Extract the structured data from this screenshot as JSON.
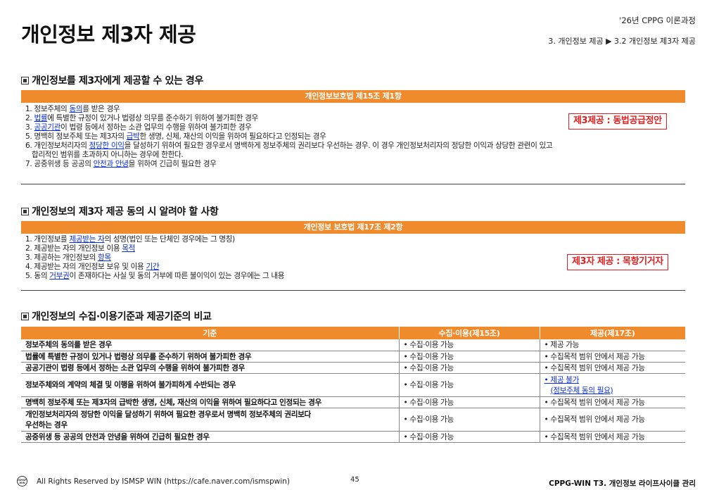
{
  "header": {
    "title": "개인정보 제3자 제공",
    "course": "'26년 CPPG 이론과정",
    "breadcrumb": "3. 개인정보 제공 ▶ 3.2 개인정보 제3자 제공"
  },
  "section1": {
    "heading": "개인정보를 제3자에게 제공할 수 있는 경우",
    "bar": "개인정보보호법 제15조 제1항",
    "callout": "제3제공 : 동법공급정안",
    "items": [
      {
        "pre": "1. 정보주체의 ",
        "kw": "동의",
        "post": "를 받은 경우"
      },
      {
        "pre": "2. ",
        "kw": "법률",
        "post": "에 특별한 규정이 있거나 법령상 의무를 준수하기 위하여 불가피한 경우"
      },
      {
        "pre": "3. ",
        "kw": "공공기관",
        "post": "이 법령 등에서 정하는 소관 업무의 수행을 위하여 불가피한 경우"
      },
      {
        "pre": "5. 명백히 정보주체 또는 제3자의 ",
        "kw": "급박",
        "post": "한 생명, 신체, 재산의 이익을 위하여 필요하다고 인정되는 경우"
      },
      {
        "pre": "6. 개인정보처리자의 ",
        "kw": "정당한 이익",
        "post": "을 달성하기 위하여 필요한 경우로서 명백하게 정보주체의 권리보다 우선하는 경우. 이 경우 개인정보처리자의 정당한 이익과 상당한 관련이 있고"
      },
      {
        "text": "합리적인 범위를 초과하지 아니하는 경우에 한한다."
      },
      {
        "pre": "7. 공중위생 등 공공의 ",
        "kw": "안전과 안녕",
        "post": "을 위하여 긴급히 필요한 경우"
      }
    ]
  },
  "section2": {
    "heading": "개인정보의 제3자 제공 동의 시 알려야 할 사항",
    "bar": "개인정보 보호법 제17조 제2항",
    "callout": "제3자 제공 : 목항기거자",
    "items": [
      {
        "pre": "1. 개인정보를 ",
        "kw": "제공받는 자",
        "post": "의 성명(법인 또는 단체인 경우에는 그 명칭)"
      },
      {
        "pre": "2. 제공받는 자의 개인정보 이용 ",
        "kw": "목적",
        "post": ""
      },
      {
        "pre": "3. 제공하는 개인정보의 ",
        "kw": "항목",
        "post": ""
      },
      {
        "pre": "4. 제공받는 자의 개인정보 보유 및 이용 ",
        "kw": "기간",
        "post": ""
      },
      {
        "pre": "5. 동의 ",
        "kw": "거부권",
        "post": "이 존재하다는 사실 및 동의 거부에 따른 불이익이 있는 경우에는 그 내용"
      }
    ]
  },
  "section3": {
    "heading": "개인정보의 수집·이용기준과 제공기준의 비교",
    "columns": [
      "기준",
      "수집·이용(제15조)",
      "제공(제17조)"
    ],
    "rows": [
      {
        "criterion": "정보주체의 동의를 받은 경우",
        "collect": "수집·이용 가능",
        "provide": "제공 가능"
      },
      {
        "criterion": "법률에 특별한 규정이 있거나 법령상 의무를 준수하기 위하여 불가피한 경우",
        "collect": "수집·이용 가능",
        "provide": "수집목적 범위 안에서 제공 가능"
      },
      {
        "criterion": "공공기관이 법령 등에서 정하는 소관 업무의 수행을 위하여 불가피한 경우",
        "collect": "수집·이용 가능",
        "provide": "수집목적 범위 안에서 제공 가능"
      },
      {
        "criterion": "정보주체와의 계약의 체결 및 이행을 위하여 불가피하게 수반되는 경우",
        "collect": "수집·이용 가능",
        "provide": "제공 불가",
        "provide_note": "(정보주체 동의 필요)"
      },
      {
        "criterion": "명백히 정보주체 또는 제3자의 급박한 생명, 신체, 재산의 이익을 위하여 필요하다고 인정되는 경우",
        "collect": "수집·이용 가능",
        "provide": "수집목적 범위 안에서 제공 가능"
      },
      {
        "criterion": "개인정보처리자의 정당한 이익을 달성하기 위하여 필요한 경우로서 명백히 정보주체의 권리보다",
        "criterion2": "우선하는 경우",
        "collect": "수집·이용 가능",
        "provide": "수집목적 범위 안에서 제공 가능"
      },
      {
        "criterion": "공중위생 등 공공의 안전과 안녕을 위하여 긴급히 필요한 경우",
        "collect": "수집·이용 가능",
        "provide": "수집목적 범위 안에서 제공 가능"
      }
    ]
  },
  "footer": {
    "logo_text": "ISMSP WIN",
    "copyright": "All Rights Reserved by ISMSP WIN (https://cafe.naver.com/ismspwin)",
    "page": "45",
    "right": "CPPG-WIN T3. 개인정보 라이프사이클 관리"
  }
}
